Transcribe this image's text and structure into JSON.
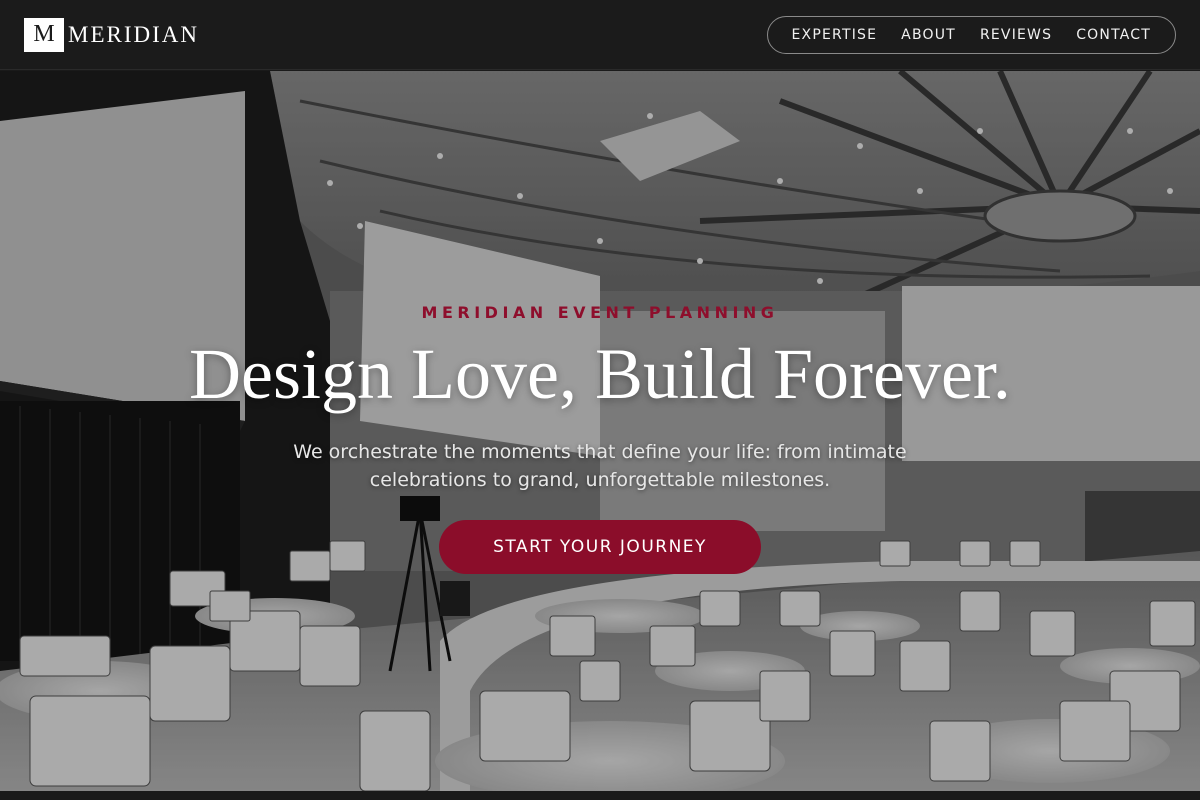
{
  "brand": {
    "mark": "M",
    "name": "MERIDIAN"
  },
  "nav": {
    "items": [
      {
        "label": "EXPERTISE"
      },
      {
        "label": "ABOUT"
      },
      {
        "label": "REVIEWS"
      },
      {
        "label": "CONTACT"
      }
    ]
  },
  "hero": {
    "eyebrow": "MERIDIAN EVENT PLANNING",
    "headline": "Design Love, Build Forever.",
    "subtext": "We orchestrate the moments that define your life: from intimate celebrations to grand, unforgettable milestones.",
    "cta_label": "START YOUR JOURNEY",
    "background_image": "event-hall-photo"
  },
  "colors": {
    "header_bg": "#1b1b1b",
    "accent": "#8b0d2a",
    "text": "#ffffff"
  }
}
